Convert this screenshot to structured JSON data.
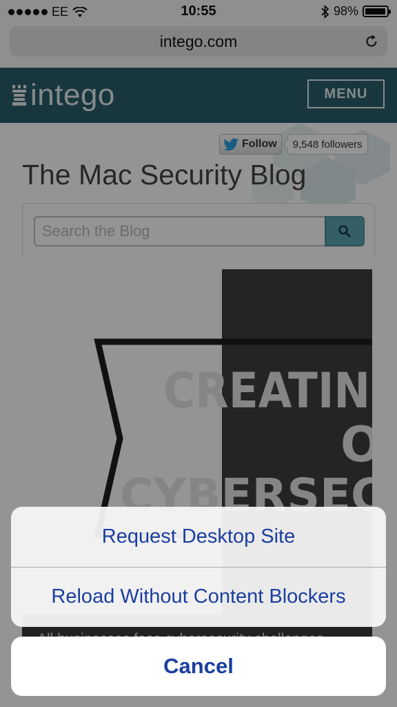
{
  "status_bar": {
    "carrier": "EE",
    "time": "10:55",
    "battery_percent": "98%",
    "battery_level": 0.98
  },
  "browser": {
    "url": "intego.com"
  },
  "site_header": {
    "logo_text": "intego",
    "menu_label": "MENU",
    "color": "#2a5e69"
  },
  "twitter": {
    "follow_label": "Follow",
    "followers": "9,548 followers"
  },
  "blog": {
    "title": "The Mac Security Blog",
    "search_placeholder": "Search the Blog"
  },
  "post": {
    "image_lines": [
      "CREATING A",
      "O",
      "CYBERSECURI"
    ],
    "excerpt": "All businesses face cybersecurity challenges"
  },
  "action_sheet": {
    "items": [
      "Request Desktop Site",
      "Reload Without Content Blockers"
    ],
    "cancel_label": "Cancel",
    "accent_color": "#1b3fa0"
  }
}
